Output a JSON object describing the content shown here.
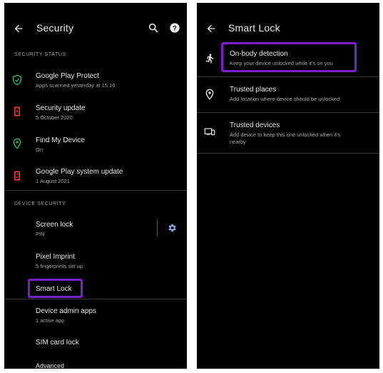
{
  "left": {
    "title": "Security",
    "status_header": "SECURITY STATUS",
    "status_items": [
      {
        "title": "Google Play Protect",
        "subtitle": "Apps scanned yesterday at 15:16",
        "icon": "shield-check-icon"
      },
      {
        "title": "Security update",
        "subtitle": "5 October 2020",
        "icon": "phone-update-icon"
      },
      {
        "title": "Find My Device",
        "subtitle": "On",
        "icon": "location-pin-icon"
      },
      {
        "title": "Google Play system update",
        "subtitle": "1 August 2021",
        "icon": "phone-sync-icon"
      }
    ],
    "device_header": "DEVICE SECURITY",
    "device_items": [
      {
        "title": "Screen lock",
        "subtitle": "PIN"
      },
      {
        "title": "Pixel Imprint",
        "subtitle": "5 fingerprints set up"
      },
      {
        "title": "Smart Lock",
        "subtitle": ""
      },
      {
        "title": "Device admin apps",
        "subtitle": "1 active app"
      },
      {
        "title": "SIM card lock",
        "subtitle": ""
      },
      {
        "title": "Advanced",
        "subtitle": ""
      }
    ]
  },
  "right": {
    "title": "Smart Lock",
    "items": [
      {
        "title": "On-body detection",
        "subtitle": "Keep your device unlocked while it's on you",
        "icon": "walking-person-icon"
      },
      {
        "title": "Trusted places",
        "subtitle": "Add location where device should be unlocked",
        "icon": "location-pin-icon"
      },
      {
        "title": "Trusted devices",
        "subtitle": "Add device to keep this one unlocked when it's",
        "subtitle2": "nearby",
        "icon": "devices-icon"
      }
    ]
  },
  "colors": {
    "background": "#000000",
    "green_icon": "#2bbd5e",
    "red_icon": "#e53935",
    "accent_blue": "#8ab4f8",
    "highlight": "#7a1fc9"
  }
}
